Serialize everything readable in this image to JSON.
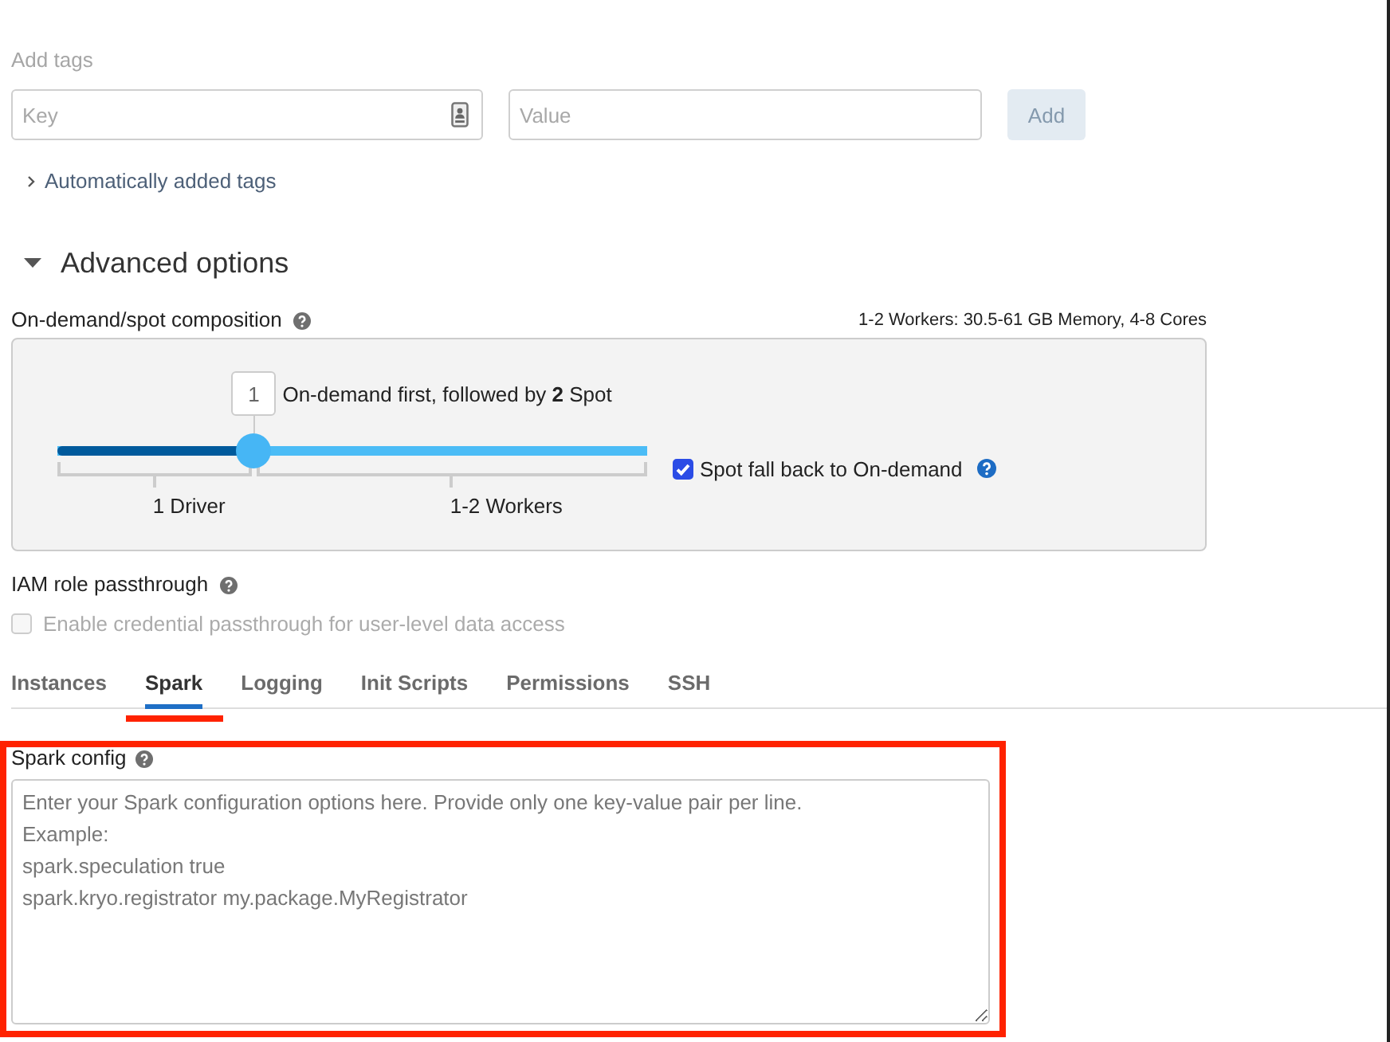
{
  "tags": {
    "hint": "Add tags",
    "key_field": {
      "placeholder": "Key"
    },
    "value_field": {
      "placeholder": "Value"
    },
    "add_button": {
      "label": "Add",
      "disabled": true
    },
    "auto_tags": {
      "label": "Automatically added tags",
      "expanded": false
    }
  },
  "advanced": {
    "title": "Advanced options",
    "expanded": true,
    "composition": {
      "label": "On-demand/spot composition",
      "summary": "1-2 Workers: 30.5-61 GB Memory, 4-8 Cores",
      "on_demand_count": "1",
      "description": "On-demand first, followed by **2** Spot",
      "slider": {
        "level": 0.333
      },
      "segments": [
        {
          "label": "1 Driver"
        },
        {
          "label": "1-2 Workers"
        }
      ],
      "fallback": {
        "label": "Spot fall back to On-demand",
        "checked": true
      }
    },
    "iam": {
      "label": "IAM role passthrough",
      "checkbox": {
        "label": "Enable credential passthrough for user-level data access",
        "checked": false,
        "disabled": true
      }
    },
    "tabs": [
      {
        "label": "Instances",
        "selected": false
      },
      {
        "label": "Spark",
        "selected": true
      },
      {
        "label": "Logging",
        "selected": false
      },
      {
        "label": "Init Scripts",
        "selected": false
      },
      {
        "label": "Permissions",
        "selected": false
      },
      {
        "label": "SSH",
        "selected": false
      }
    ],
    "spark_config": {
      "label": "Spark config",
      "placeholder": "Enter your Spark configuration options here. Provide only one key-value pair per line.\nExample:\nspark.speculation true\nspark.kryo.registrator my.package.MyRegistrator"
    }
  }
}
